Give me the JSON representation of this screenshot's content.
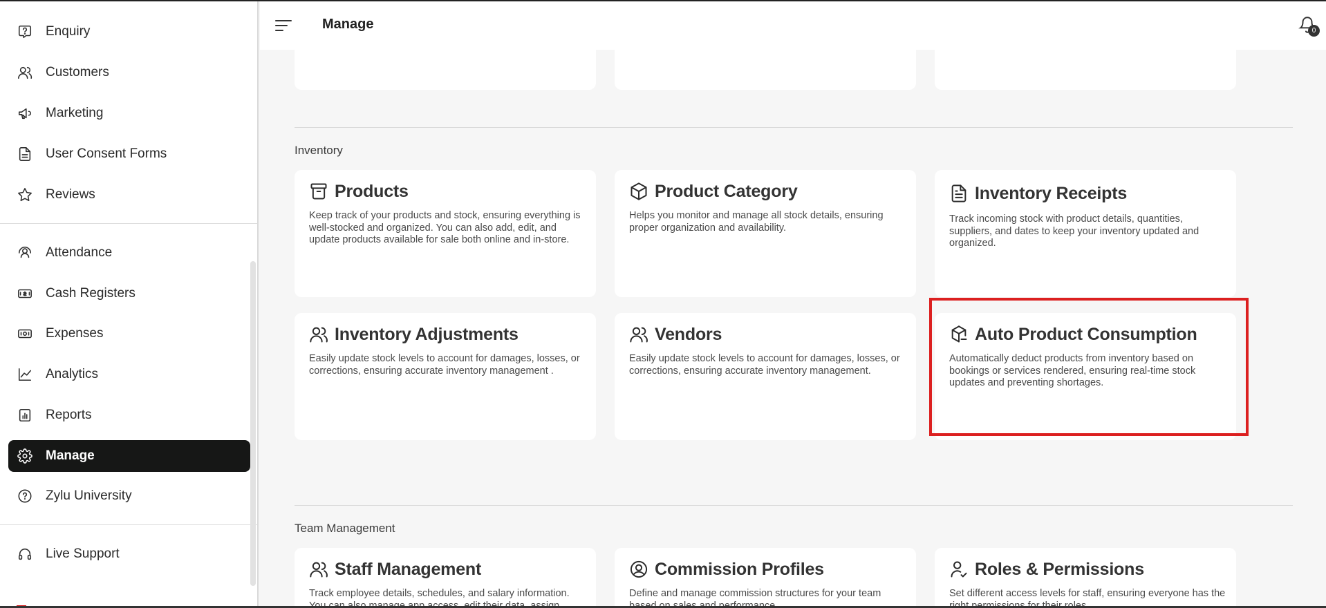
{
  "header": {
    "title": "Manage",
    "notification_count": "0"
  },
  "sidebar": {
    "items": [
      {
        "label": "Enquiry",
        "icon": "enquiry-icon"
      },
      {
        "label": "Customers",
        "icon": "customers-icon"
      },
      {
        "label": "Marketing",
        "icon": "megaphone-icon"
      },
      {
        "label": "User Consent Forms",
        "icon": "document-icon"
      },
      {
        "label": "Reviews",
        "icon": "star-icon"
      },
      {
        "label": "Attendance",
        "icon": "attendance-icon"
      },
      {
        "label": "Cash Registers",
        "icon": "cash-register-icon"
      },
      {
        "label": "Expenses",
        "icon": "expenses-icon"
      },
      {
        "label": "Analytics",
        "icon": "analytics-icon"
      },
      {
        "label": "Reports",
        "icon": "reports-icon"
      },
      {
        "label": "Manage",
        "icon": "gear-icon",
        "active": true
      },
      {
        "label": "Zylu University",
        "icon": "help-icon"
      },
      {
        "label": "Live Support",
        "icon": "headset-icon"
      }
    ]
  },
  "sections": {
    "inventory": {
      "label": "Inventory",
      "cards": [
        {
          "title": "Products",
          "icon": "archive-box-icon",
          "desc": "Keep track of your products and stock, ensuring everything is well-stocked and organized. You can also add, edit, and update products available for sale both online and in-store."
        },
        {
          "title": "Product Category",
          "icon": "cube-icon",
          "desc": "Helps you monitor and manage all stock details, ensuring proper organization and availability."
        },
        {
          "title": "Inventory Receipts",
          "icon": "receipt-icon",
          "desc": "Track incoming stock with product details, quantities, suppliers, and dates to keep your inventory updated and organized."
        },
        {
          "title": "Inventory Adjustments",
          "icon": "users-icon",
          "desc": "Easily update stock levels to account for damages, losses, or corrections, ensuring accurate inventory management ."
        },
        {
          "title": "Vendors",
          "icon": "users-icon",
          "desc": "Easily update stock levels to account for damages, losses, or corrections, ensuring accurate inventory management."
        },
        {
          "title": "Auto Product Consumption",
          "icon": "package-minus-icon",
          "desc": "Automatically deduct products from inventory based on bookings or services rendered, ensuring real-time stock updates and preventing shortages."
        }
      ]
    },
    "team": {
      "label": "Team Management",
      "cards": [
        {
          "title": "Staff Management",
          "icon": "users-icon",
          "desc": "Track employee details, schedules, and salary information. You can also manage app access, edit their data, assign"
        },
        {
          "title": "Commission Profiles",
          "icon": "user-circle-icon",
          "desc": "Define and manage commission structures for your team based on sales and performance."
        },
        {
          "title": "Roles & Permissions",
          "icon": "user-check-icon",
          "desc": "Set different access levels for staff, ensuring everyone has the right permissions for their roles."
        }
      ]
    }
  }
}
